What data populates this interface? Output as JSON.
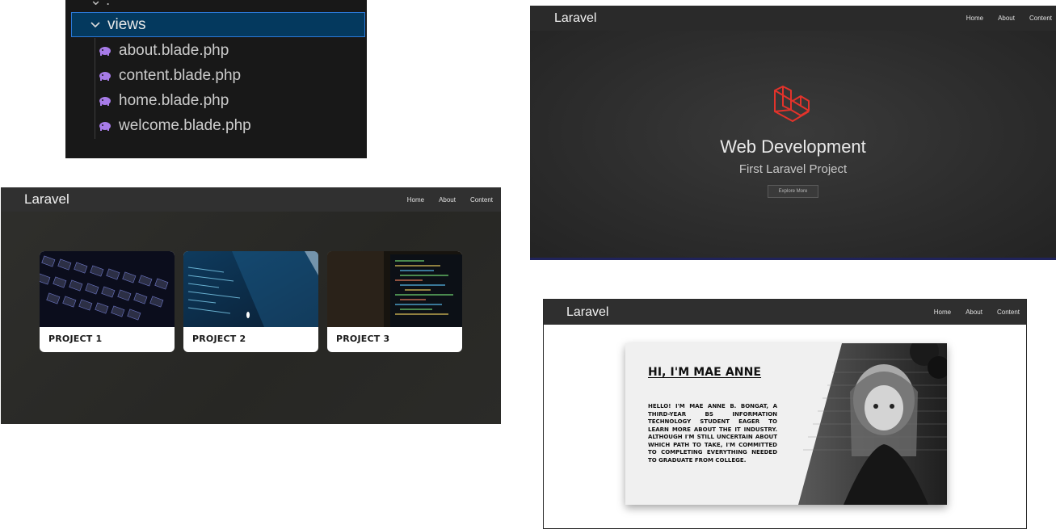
{
  "explorer": {
    "folder": "views",
    "files": [
      "about.blade.php",
      "content.blade.php",
      "home.blade.php",
      "welcome.blade.php"
    ]
  },
  "content_page": {
    "brand": "Laravel",
    "nav": [
      "Home",
      "About",
      "Content"
    ],
    "projects": [
      "PROJECT 1",
      "PROJECT 2",
      "PROJECT 3"
    ]
  },
  "home_page": {
    "brand": "Laravel",
    "nav": [
      "Home",
      "About",
      "Content"
    ],
    "title": "Web Development",
    "subtitle": "First Laravel Project",
    "button": "Explore More"
  },
  "about_page": {
    "brand": "Laravel",
    "nav": [
      "Home",
      "About",
      "Content"
    ],
    "heading": "HI, I'M MAE ANNE",
    "bio": "HELLO! I'M MAE ANNE B. BONGAT, A THIRD-YEAR BS INFORMATION TECHNOLOGY STUDENT EAGER TO LEARN MORE ABOUT THE IT INDUSTRY. ALTHOUGH I'M STILL UNCERTAIN ABOUT WHICH PATH TO TAKE, I'M COMMITTED TO COMPLETING EVERYTHING NEEDED TO GRADUATE FROM COLLEGE."
  },
  "colors": {
    "vscode_bg": "#181818",
    "vscode_selection_border": "#2b79d8",
    "php_icon": "#a77be8",
    "laravel_red": "#e2332b"
  },
  "icons": [
    "chevron-down-icon",
    "php-elephant-icon",
    "laravel-logo-icon"
  ]
}
